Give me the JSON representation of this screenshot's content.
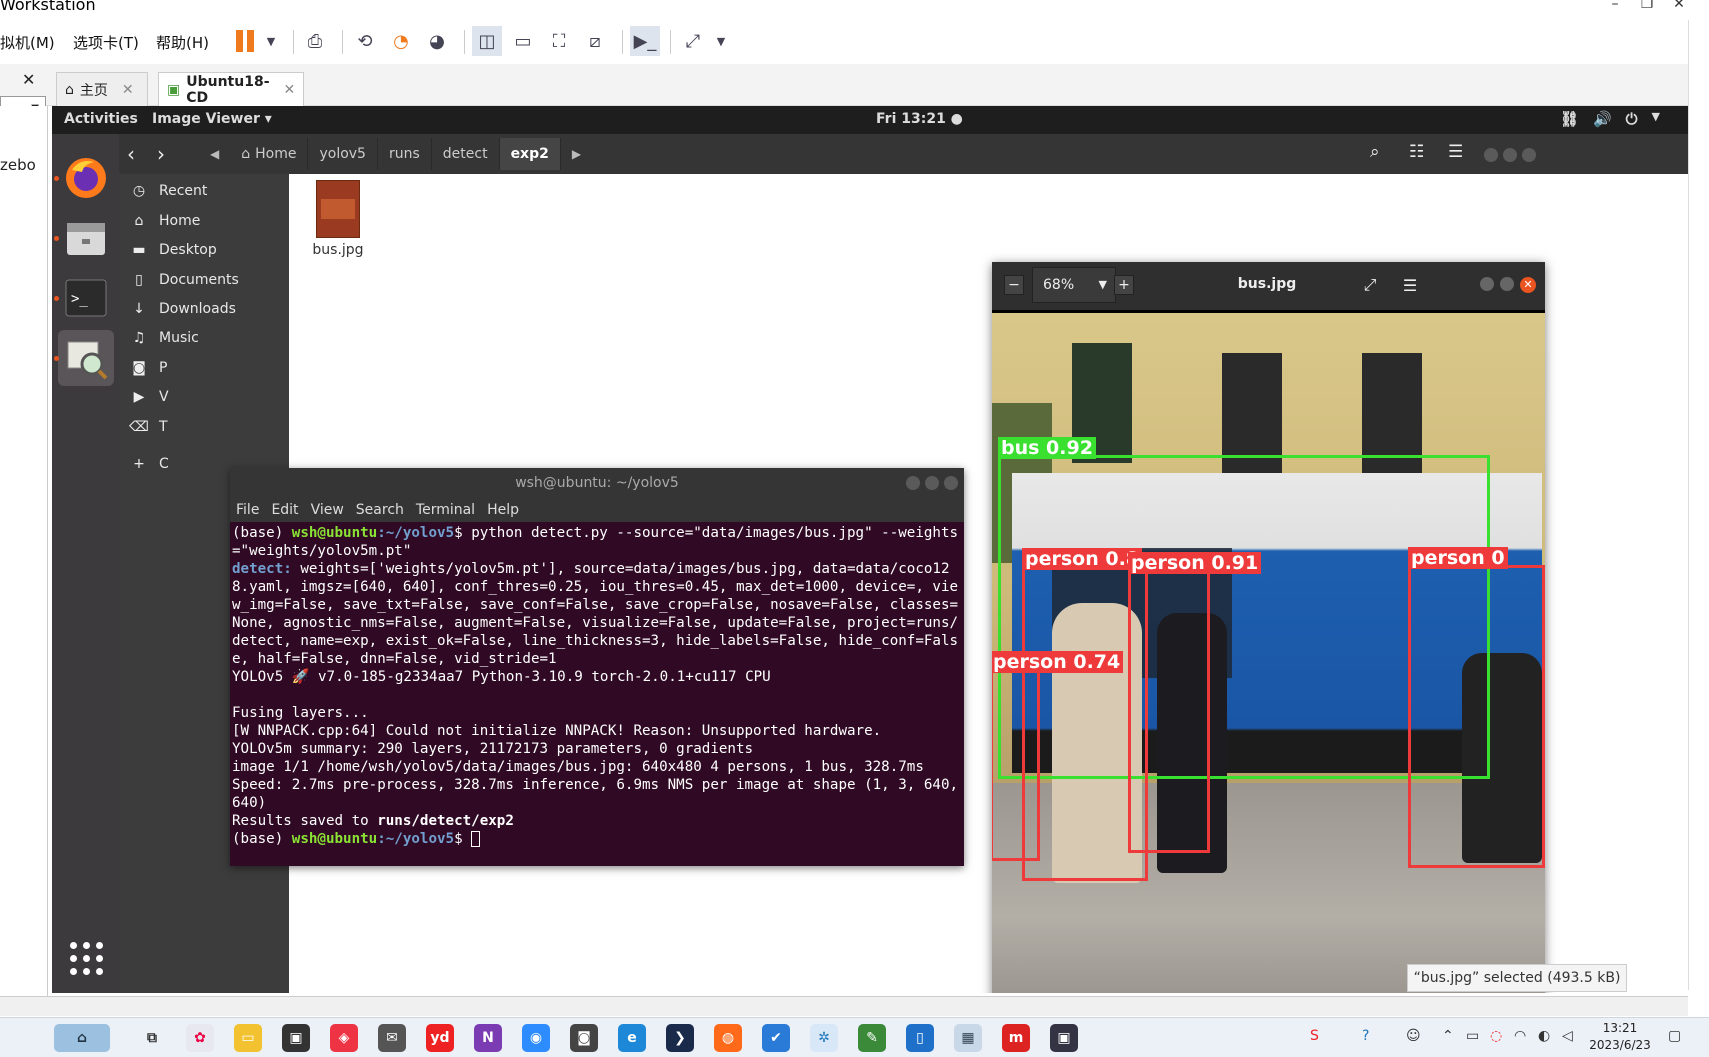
{
  "host": {
    "title": "Workstation",
    "menus": [
      "拟机(M)",
      "选项卡(T)",
      "帮助(H)"
    ],
    "tabs": [
      {
        "label": "主页",
        "icon": "home-icon"
      },
      {
        "label": "Ubuntu18-CD",
        "icon": "vm-icon"
      }
    ],
    "left_panel_text": "zebo"
  },
  "ubuntu": {
    "activities": "Activities",
    "app_menu": "Image Viewer ▾",
    "clock": "Fri 13:21 ●"
  },
  "files": {
    "breadcrumbs": [
      "Home",
      "yolov5",
      "runs",
      "detect",
      "exp2"
    ],
    "sidebar": [
      {
        "label": "Recent",
        "icon": "clock-icon"
      },
      {
        "label": "Home",
        "icon": "home-icon"
      },
      {
        "label": "Desktop",
        "icon": "desktop-icon"
      },
      {
        "label": "Documents",
        "icon": "document-icon"
      },
      {
        "label": "Downloads",
        "icon": "download-icon"
      },
      {
        "label": "Music",
        "icon": "music-icon"
      },
      {
        "label": "P",
        "icon": "camera-icon"
      },
      {
        "label": "V",
        "icon": "video-icon"
      },
      {
        "label": "T",
        "icon": "trash-icon"
      },
      {
        "label": "C",
        "icon": "plus-icon"
      }
    ],
    "file": {
      "name": "bus.jpg"
    },
    "status": "“bus.jpg” selected  (493.5 kB)"
  },
  "terminal": {
    "title": "wsh@ubuntu: ~/yolov5",
    "menus": [
      "File",
      "Edit",
      "View",
      "Search",
      "Terminal",
      "Help"
    ],
    "prompt_env": "(base) ",
    "prompt_user": "wsh@ubuntu",
    "prompt_path": ":~/yolov5",
    "prompt_sign": "$ ",
    "command": "python detect.py --source=\"data/images/bus.jpg\" --weights=\"weights/yolov5m.pt\"",
    "detect_tag": "detect: ",
    "detect_args": "weights=['weights/yolov5m.pt'], source=data/images/bus.jpg, data=data/coco128.yaml, imgsz=[640, 640], conf_thres=0.25, iou_thres=0.45, max_det=1000, device=, view_img=False, save_txt=False, save_conf=False, save_crop=False, nosave=False, classes=None, agnostic_nms=False, augment=False, visualize=False, update=False, project=runs/detect, name=exp, exist_ok=False, line_thickness=3, hide_labels=False, hide_conf=False, half=False, dnn=False, vid_stride=1",
    "version_line": "YOLOv5 🚀 v7.0-185-g2334aa7 Python-3.10.9 torch-2.0.1+cu117 CPU",
    "fusing": "Fusing layers... ",
    "warning": "[W NNPACK.cpp:64] Could not initialize NNPACK! Reason: Unsupported hardware.",
    "summary": "YOLOv5m summary: 290 layers, 21172173 parameters, 0 gradients",
    "image_line": "image 1/1 /home/wsh/yolov5/data/images/bus.jpg: 640x480 4 persons, 1 bus, 328.7ms",
    "speed": "Speed: 2.7ms pre-process, 328.7ms inference, 6.9ms NMS per image at shape (1, 3, 640, 640)",
    "results_prefix": "Results saved to ",
    "results_path": "runs/detect/exp2"
  },
  "viewer": {
    "title": "bus.jpg",
    "zoom": "68%",
    "detections": [
      {
        "label": "bus 0.92",
        "color": "#39e02f"
      },
      {
        "label": "person 0.8",
        "color": "#ee3a3a"
      },
      {
        "label": "person 0.91",
        "color": "#ee3a3a"
      },
      {
        "label": "person 0",
        "color": "#ee3a3a"
      },
      {
        "label": "person 0.74",
        "color": "#ee3a3a"
      }
    ]
  },
  "taskbar": {
    "time": "13:21",
    "date": "2023/6/23"
  },
  "colors": {
    "ubuntu_orange": "#e95420",
    "terminal_bg": "#300a24",
    "prompt_green": "#8ae234",
    "prompt_blue": "#729fcf"
  }
}
